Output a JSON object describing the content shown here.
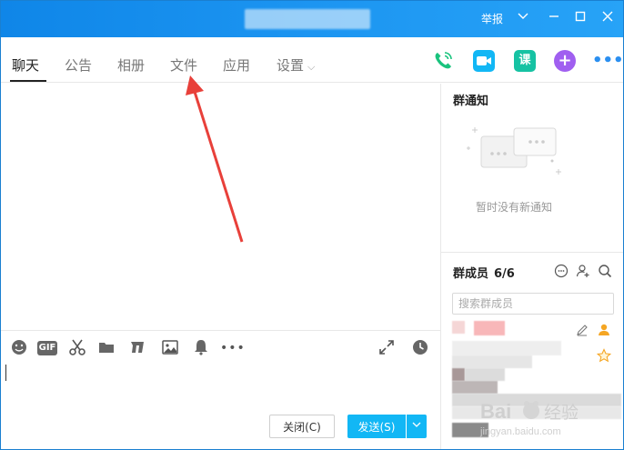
{
  "titlebar": {
    "report_label": "举报"
  },
  "tabs": [
    {
      "label": "聊天",
      "active": true
    },
    {
      "label": "公告",
      "active": false
    },
    {
      "label": "相册",
      "active": false
    },
    {
      "label": "文件",
      "active": false
    },
    {
      "label": "应用",
      "active": false
    },
    {
      "label": "设置",
      "active": false
    }
  ],
  "toolbar": {
    "class_label": "课"
  },
  "notice": {
    "title": "群通知",
    "empty_text": "暂时没有新通知"
  },
  "members": {
    "title": "群成员",
    "count": "6/6",
    "search_placeholder": "搜索群成员"
  },
  "footer": {
    "close_label": "关闭(C)",
    "send_label": "发送(S)"
  },
  "watermark": {
    "brand": "Bai",
    "brand2": "经验",
    "url": "jingyan.baidu.com"
  },
  "colors": {
    "titlebar": "#1c95f1",
    "send": "#12b7f5",
    "arrow": "#e8403a",
    "phone": "#19c37d",
    "video": "#12b7f5",
    "class": "#16c2a3",
    "apps": "#a05ff0"
  }
}
